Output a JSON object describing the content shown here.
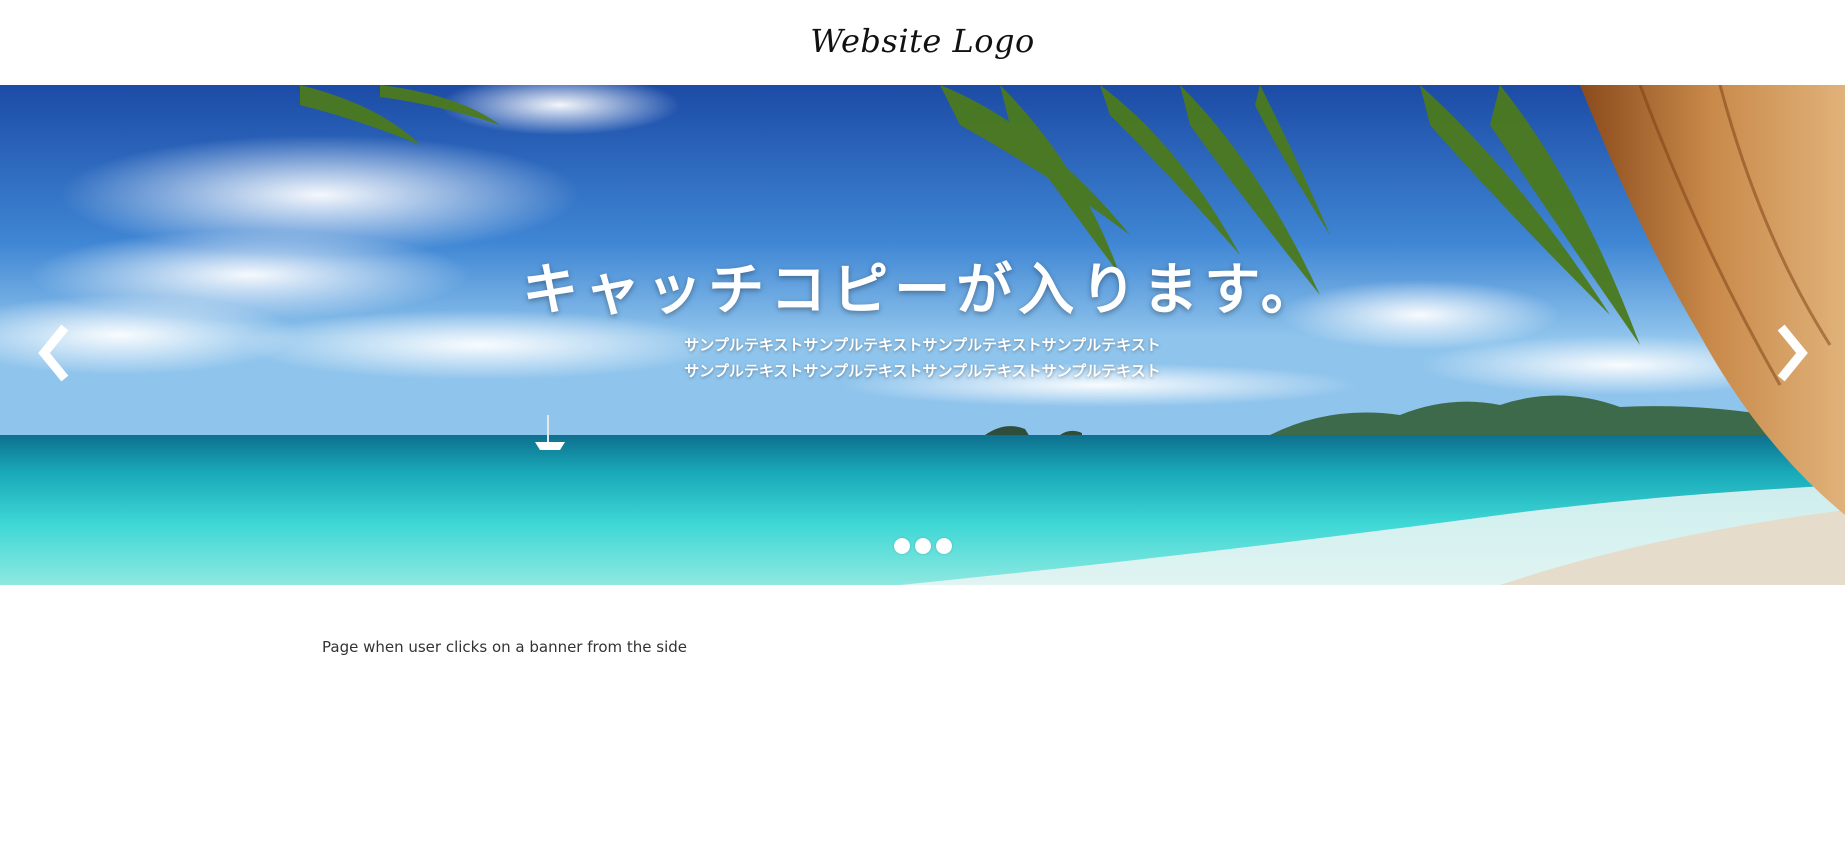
{
  "header": {
    "logo_text": "Website Logo"
  },
  "hero": {
    "headline": "キャッチコピーが入ります。",
    "subtext_lines": [
      "サンプルテキストサンプルテキストサンプルテキストサンプルテキスト",
      "サンプルテキストサンプルテキストサンプルテキストサンプルテキスト"
    ],
    "prev_icon": "chevron-left-icon",
    "next_icon": "chevron-right-icon",
    "slide_count": 3,
    "background_scene": "tropical beach with palm trees"
  },
  "main": {
    "text": "Page when user clicks on a banner from the side"
  },
  "colors": {
    "sky_top": "#1e4fa8",
    "sea": "#2ad0d0",
    "overlay_text": "#ffffff"
  }
}
